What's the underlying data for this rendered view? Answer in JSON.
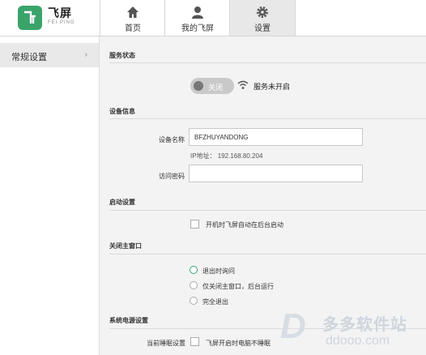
{
  "brand": {
    "name": "飞屏",
    "sub": "FEI PING"
  },
  "tabs": [
    {
      "label": "首页",
      "icon": "home-icon",
      "active": false
    },
    {
      "label": "我的飞屏",
      "icon": "user-icon",
      "active": false
    },
    {
      "label": "设置",
      "icon": "gear-icon",
      "active": true
    }
  ],
  "sidebar": {
    "items": [
      {
        "label": "常规设置",
        "chevron": "›"
      }
    ]
  },
  "service": {
    "title": "服务状态",
    "toggle_label": "关闭",
    "status_text": "服务未开启"
  },
  "device": {
    "title": "设备信息",
    "name_label": "设备名称",
    "name_value": "BFZHUYANDONG",
    "ip_text": "IP地址： 192.168.80.204",
    "password_label": "访问密码",
    "password_value": ""
  },
  "startup": {
    "title": "启动设置",
    "option": "开机时飞屏自动在后台启动"
  },
  "close_window": {
    "title": "关闭主窗口",
    "options": [
      "退出时询问",
      "仅关闭主窗口，后台运行",
      "完全退出"
    ]
  },
  "power": {
    "title": "系统电源设置",
    "label": "当前睡眠设置",
    "option": "飞屏开启时电脑不睡眠"
  },
  "watermark": {
    "logo_letter": "D",
    "name": "多多软件站",
    "url": "ddooo.com"
  },
  "colors": {
    "accent": "#3aa36a"
  }
}
